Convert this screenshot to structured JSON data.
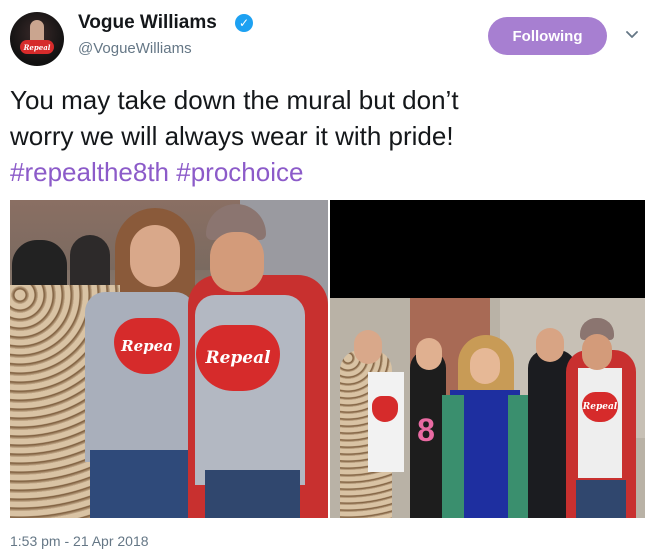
{
  "user": {
    "display_name": "Vogue Williams",
    "handle": "@VogueWilliams",
    "avatar_logo_text": "Repeal",
    "verified_icon": "verified-badge-icon"
  },
  "actions": {
    "follow_label": "Following",
    "menu_icon": "chevron-down-icon"
  },
  "tweet": {
    "text_line1": "You may take down the mural but don’t",
    "text_line2": "worry we will always wear it with pride!",
    "hashtag1": "#repealthe8th",
    "hashtag2": "#prochoice",
    "timestamp": "1:53 pm - 21 Apr 2018"
  },
  "media": {
    "left_shirt_text": "Repea",
    "left_shirt_text2": "Repeal",
    "right_shirt_text": "Repeal",
    "right_number": "8"
  },
  "colors": {
    "follow_button": "#a77fd1",
    "hashtag": "#8c5bc9",
    "verified": "#1da1f2",
    "repeal_red": "#d62b2b"
  }
}
